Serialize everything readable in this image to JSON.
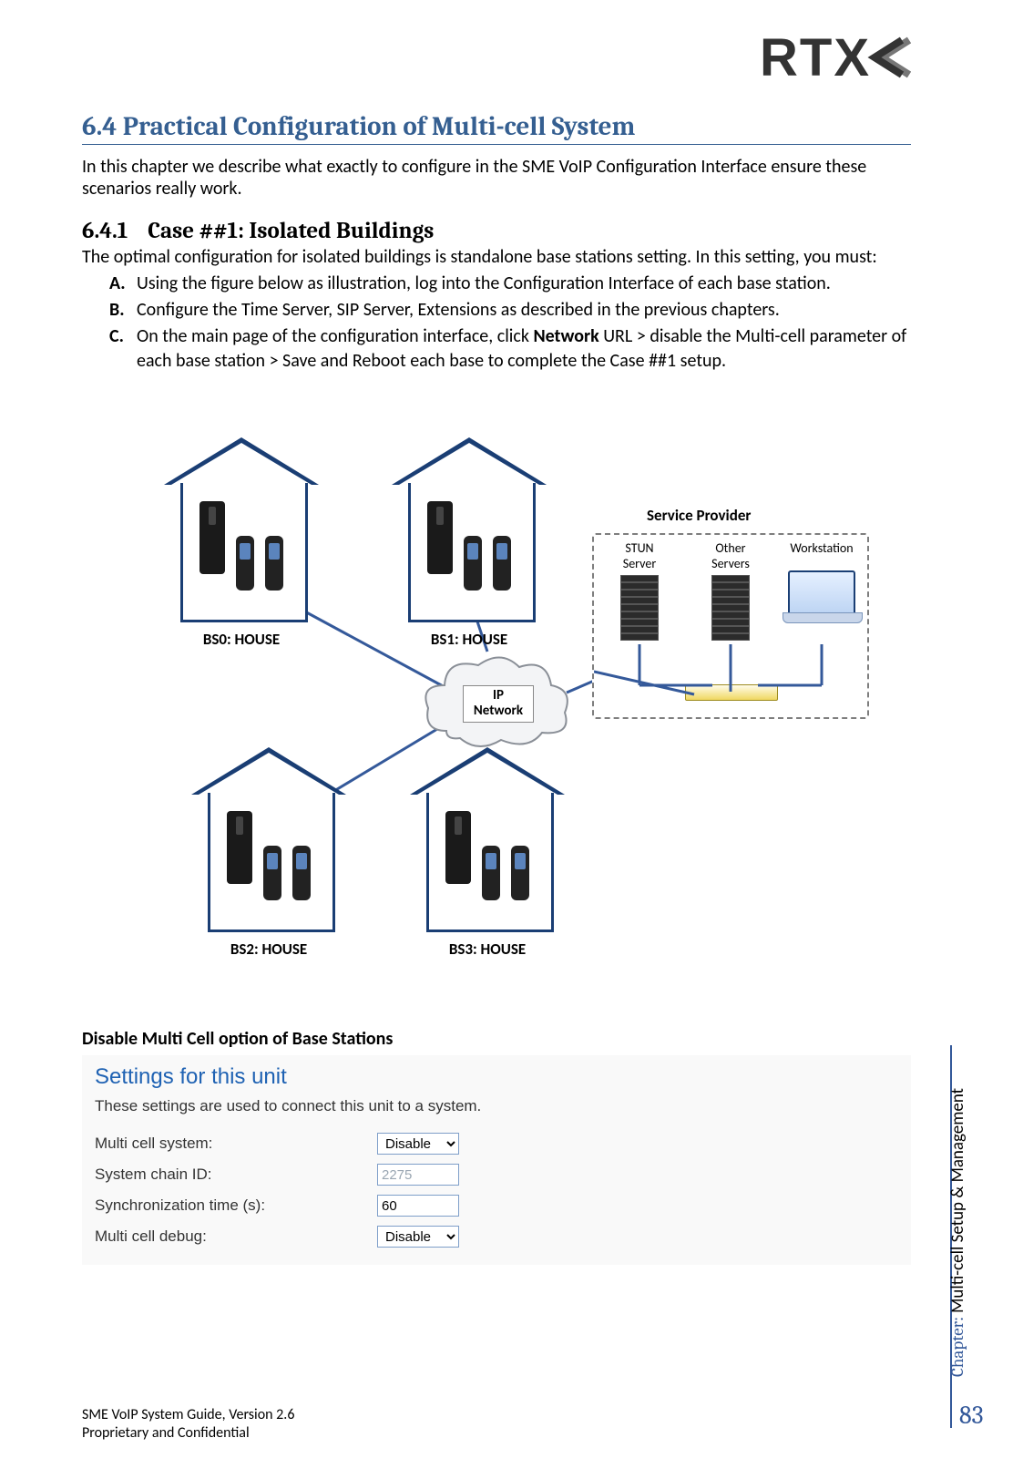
{
  "logo": {
    "text": "RTX"
  },
  "section": {
    "num": "6.4",
    "title": "Practical Configuration of Multi-cell System"
  },
  "intro": "In this chapter we describe what exactly to configure in the SME VoIP Configuration Interface ensure these scenarios really work.",
  "subsection": {
    "num": "6.4.1",
    "title": "Case ##1: Isolated Buildings"
  },
  "sub_body": "The optimal configuration for isolated buildings is standalone base stations setting. In this setting, you must:",
  "steps": {
    "a": "Using the figure below as illustration, log into the Configuration Interface of each base station.",
    "b": "Configure the Time Server, SIP Server, Extensions as described in the previous chapters.",
    "c_pre": "On the main page of the configuration interface, click ",
    "c_bold": "Network",
    "c_post": " URL > disable the Multi-cell parameter of each base station > Save and Reboot each base to complete the Case ##1 setup."
  },
  "diagram": {
    "bs0": "BS0: HOUSE",
    "bs1": "BS1: HOUSE",
    "bs2": "BS2: HOUSE",
    "bs3": "BS3: HOUSE",
    "cloud_line1": "IP",
    "cloud_line2": "Network",
    "sp_title": "Service Provider",
    "stun": "STUN\nServer",
    "other": "Other\nServers",
    "workstation": "Workstation"
  },
  "settings_caption": "Disable Multi Cell option of Base Stations",
  "settings": {
    "title": "Settings for this unit",
    "desc": "These settings are used to connect this unit to a system.",
    "rows": {
      "multi_label": "Multi cell system:",
      "multi_value": "Disable",
      "chain_label": "System chain ID:",
      "chain_value": "2275",
      "sync_label": "Synchronization time (s):",
      "sync_value": "60",
      "debug_label": "Multi cell debug:",
      "debug_value": "Disable"
    }
  },
  "side": {
    "page": "83",
    "chapter_label": "Chapter: ",
    "chapter_value": "Multi-cell Setup & Management"
  },
  "footer": {
    "line1": "SME VoIP System Guide, Version 2.6",
    "line2": "Proprietary and Confidential"
  }
}
